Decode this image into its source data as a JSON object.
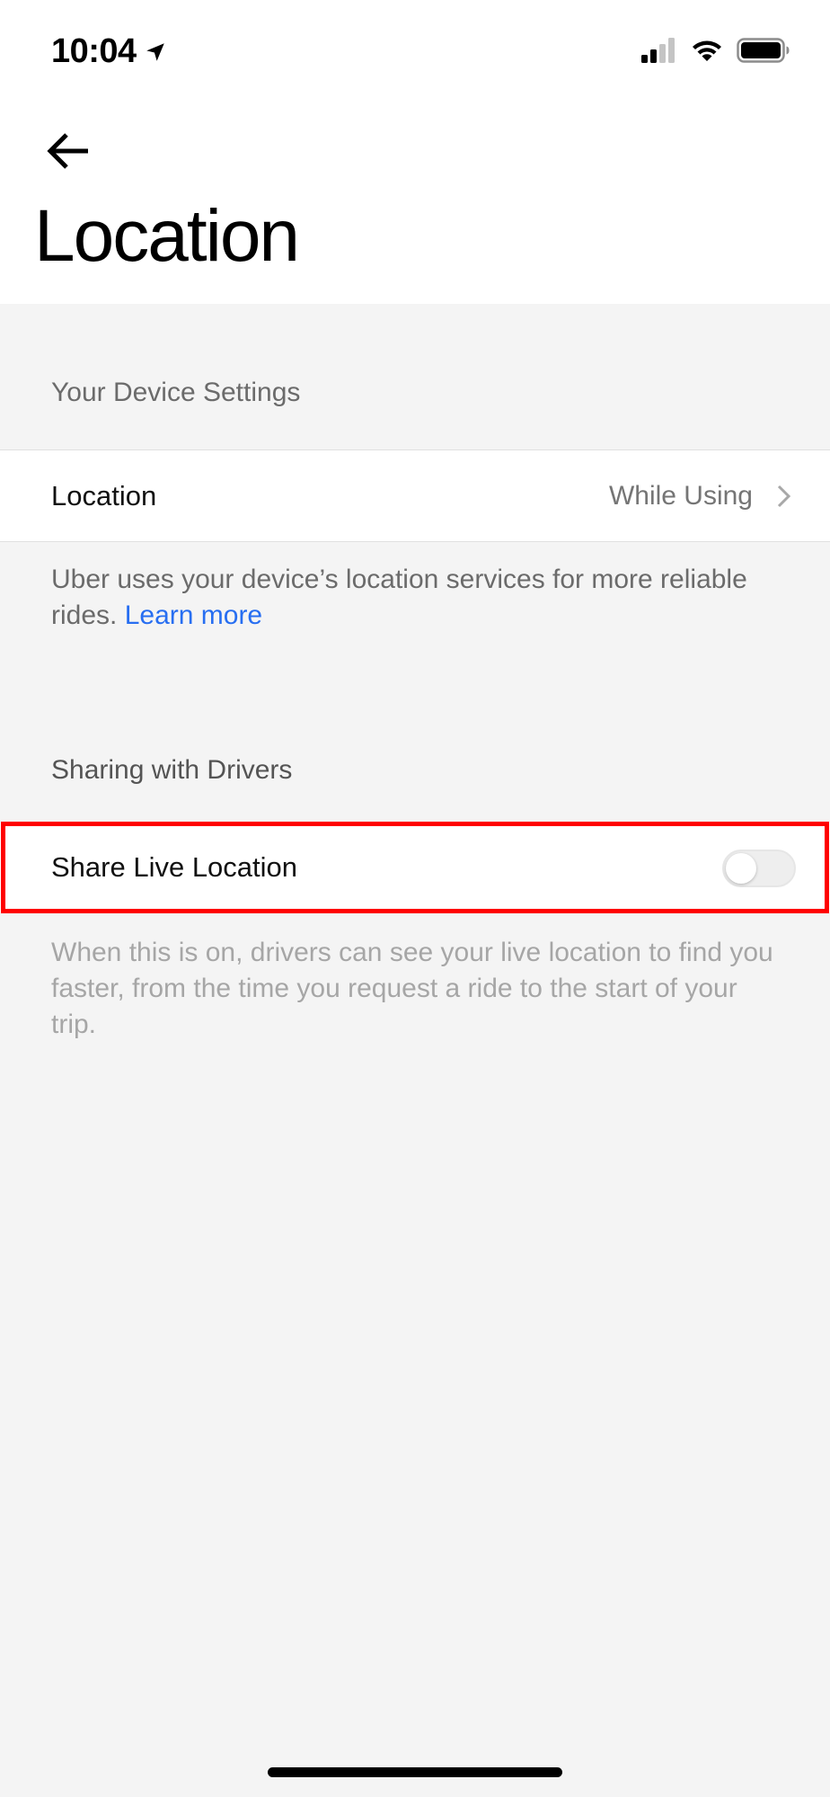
{
  "status_bar": {
    "time": "10:04",
    "icons": [
      "location-arrow-icon",
      "cellular-signal-icon",
      "wifi-icon",
      "battery-icon"
    ]
  },
  "header": {
    "back_icon": "arrow-left-icon",
    "title": "Location"
  },
  "device_settings": {
    "section_title": "Your Device Settings",
    "location_row": {
      "label": "Location",
      "value": "While Using",
      "icon": "chevron-right-icon"
    },
    "footnote_text": "Uber uses your device’s location services for more reliable rides.",
    "footnote_link": "Learn more"
  },
  "sharing": {
    "section_title": "Sharing with Drivers",
    "share_row": {
      "label": "Share Live Location",
      "toggle_on": false
    },
    "footnote_text": "When this is on, drivers can see your live location to find you faster, from the time you request a ride to the start of your trip."
  },
  "colors": {
    "link": "#276ef1",
    "highlight": "#ff0000",
    "background": "#f4f4f4"
  }
}
